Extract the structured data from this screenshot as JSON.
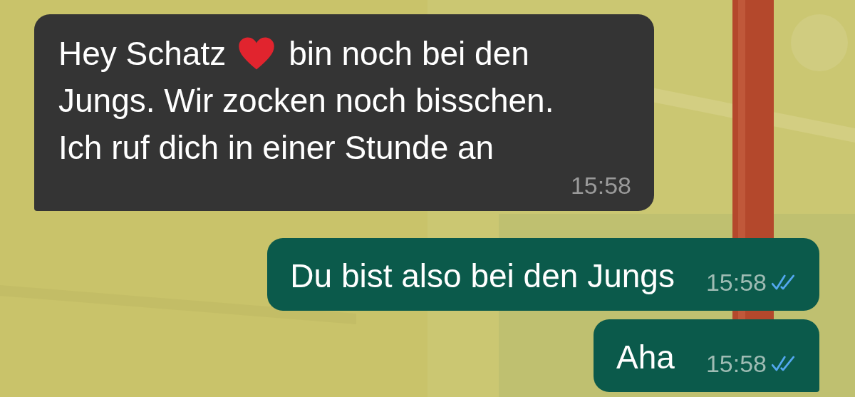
{
  "messages": [
    {
      "kind": "incoming",
      "lines": [
        [
          {
            "kind": "text",
            "text": "Hey Schatz"
          },
          {
            "kind": "heart"
          },
          {
            "kind": "text",
            "text": "bin noch bei den"
          }
        ],
        [
          {
            "kind": "text",
            "text": "Jungs. Wir zocken noch bisschen."
          }
        ],
        [
          {
            "kind": "text",
            "text": "Ich ruf dich in einer Stunde an"
          }
        ]
      ],
      "time": "15:58",
      "tail": true
    },
    {
      "kind": "outgoing",
      "lines": [
        [
          {
            "kind": "text",
            "text": "Du bist also bei den Jungs"
          }
        ]
      ],
      "time": "15:58",
      "read": true,
      "tail": false
    },
    {
      "kind": "outgoing",
      "lines": [
        [
          {
            "kind": "text",
            "text": "Aha"
          }
        ]
      ],
      "time": "15:58",
      "read": true,
      "tail": true
    }
  ]
}
